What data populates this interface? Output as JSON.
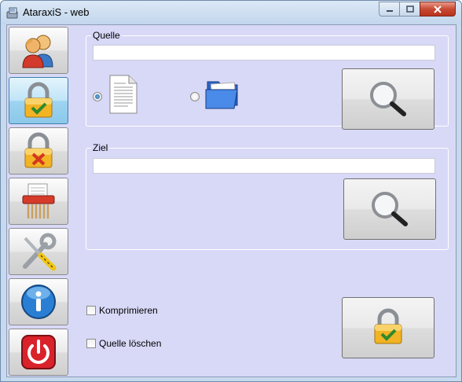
{
  "window": {
    "title": "AtaraxiS - web"
  },
  "sidebar": {
    "items": [
      {
        "icon": "users-icon"
      },
      {
        "icon": "lock-check-icon"
      },
      {
        "icon": "lock-x-icon"
      },
      {
        "icon": "shredder-icon"
      },
      {
        "icon": "tools-icon"
      },
      {
        "icon": "info-icon"
      },
      {
        "icon": "power-icon"
      }
    ]
  },
  "source": {
    "label": "Quelle",
    "path_value": "",
    "option_file_selected": true,
    "option_folder_selected": false
  },
  "target": {
    "label": "Ziel",
    "path_value": ""
  },
  "options": {
    "compress_label": "Komprimieren",
    "compress_checked": false,
    "delete_source_label": "Quelle löschen",
    "delete_source_checked": false
  },
  "colors": {
    "client_bg": "#d8d9f7",
    "active_button": "#9dd4f0",
    "close_button": "#c84a34"
  }
}
